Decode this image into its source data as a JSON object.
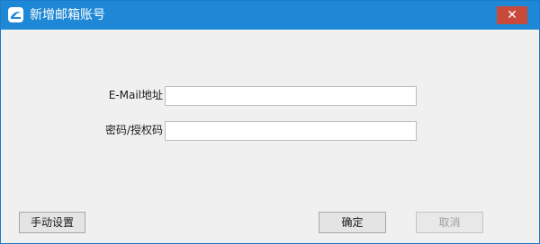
{
  "window": {
    "title": "新增邮箱账号",
    "app_icon": "mail-app-icon",
    "close_glyph": "✕",
    "titlebar_color": "#1e88d6",
    "close_color": "#c94a3a"
  },
  "form": {
    "email_label": "E-Mail地址",
    "email_value": "",
    "password_label": "密码/授权码",
    "password_value": ""
  },
  "buttons": {
    "manual_settings_label": "手动设置",
    "confirm_label": "确定",
    "cancel_label": "取消"
  }
}
